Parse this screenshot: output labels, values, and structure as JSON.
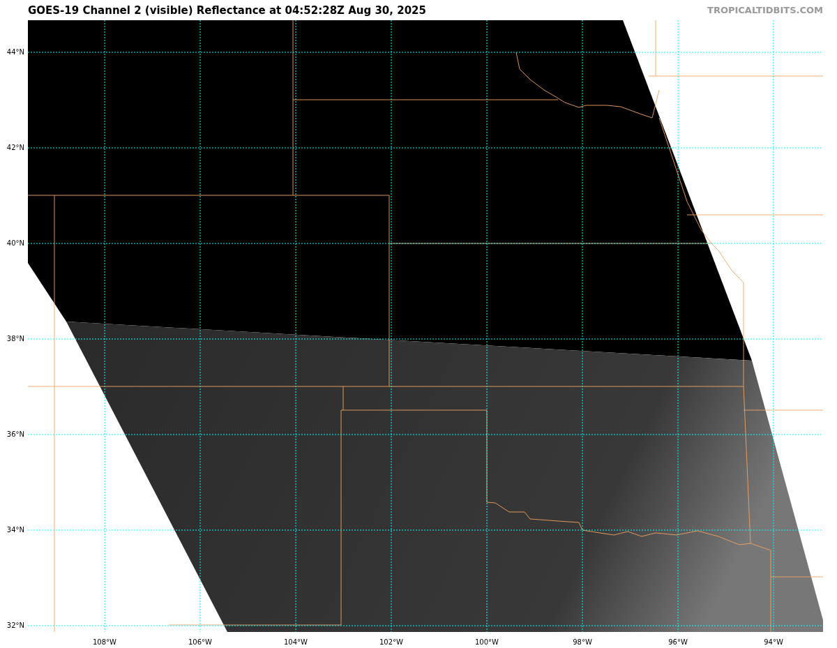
{
  "title": "GOES-19 Channel 2 (visible) Reflectance at 04:52:28Z Aug 30, 2025",
  "credit": "TROPICALTIDBITS.COM",
  "lat_labels": [
    "44°N",
    "42°N",
    "40°N",
    "38°N",
    "36°N",
    "34°N",
    "32°N"
  ],
  "lon_labels": [
    "108°W",
    "106°W",
    "104°W",
    "102°W",
    "100°W",
    "98°W",
    "96°W",
    "94°W"
  ]
}
